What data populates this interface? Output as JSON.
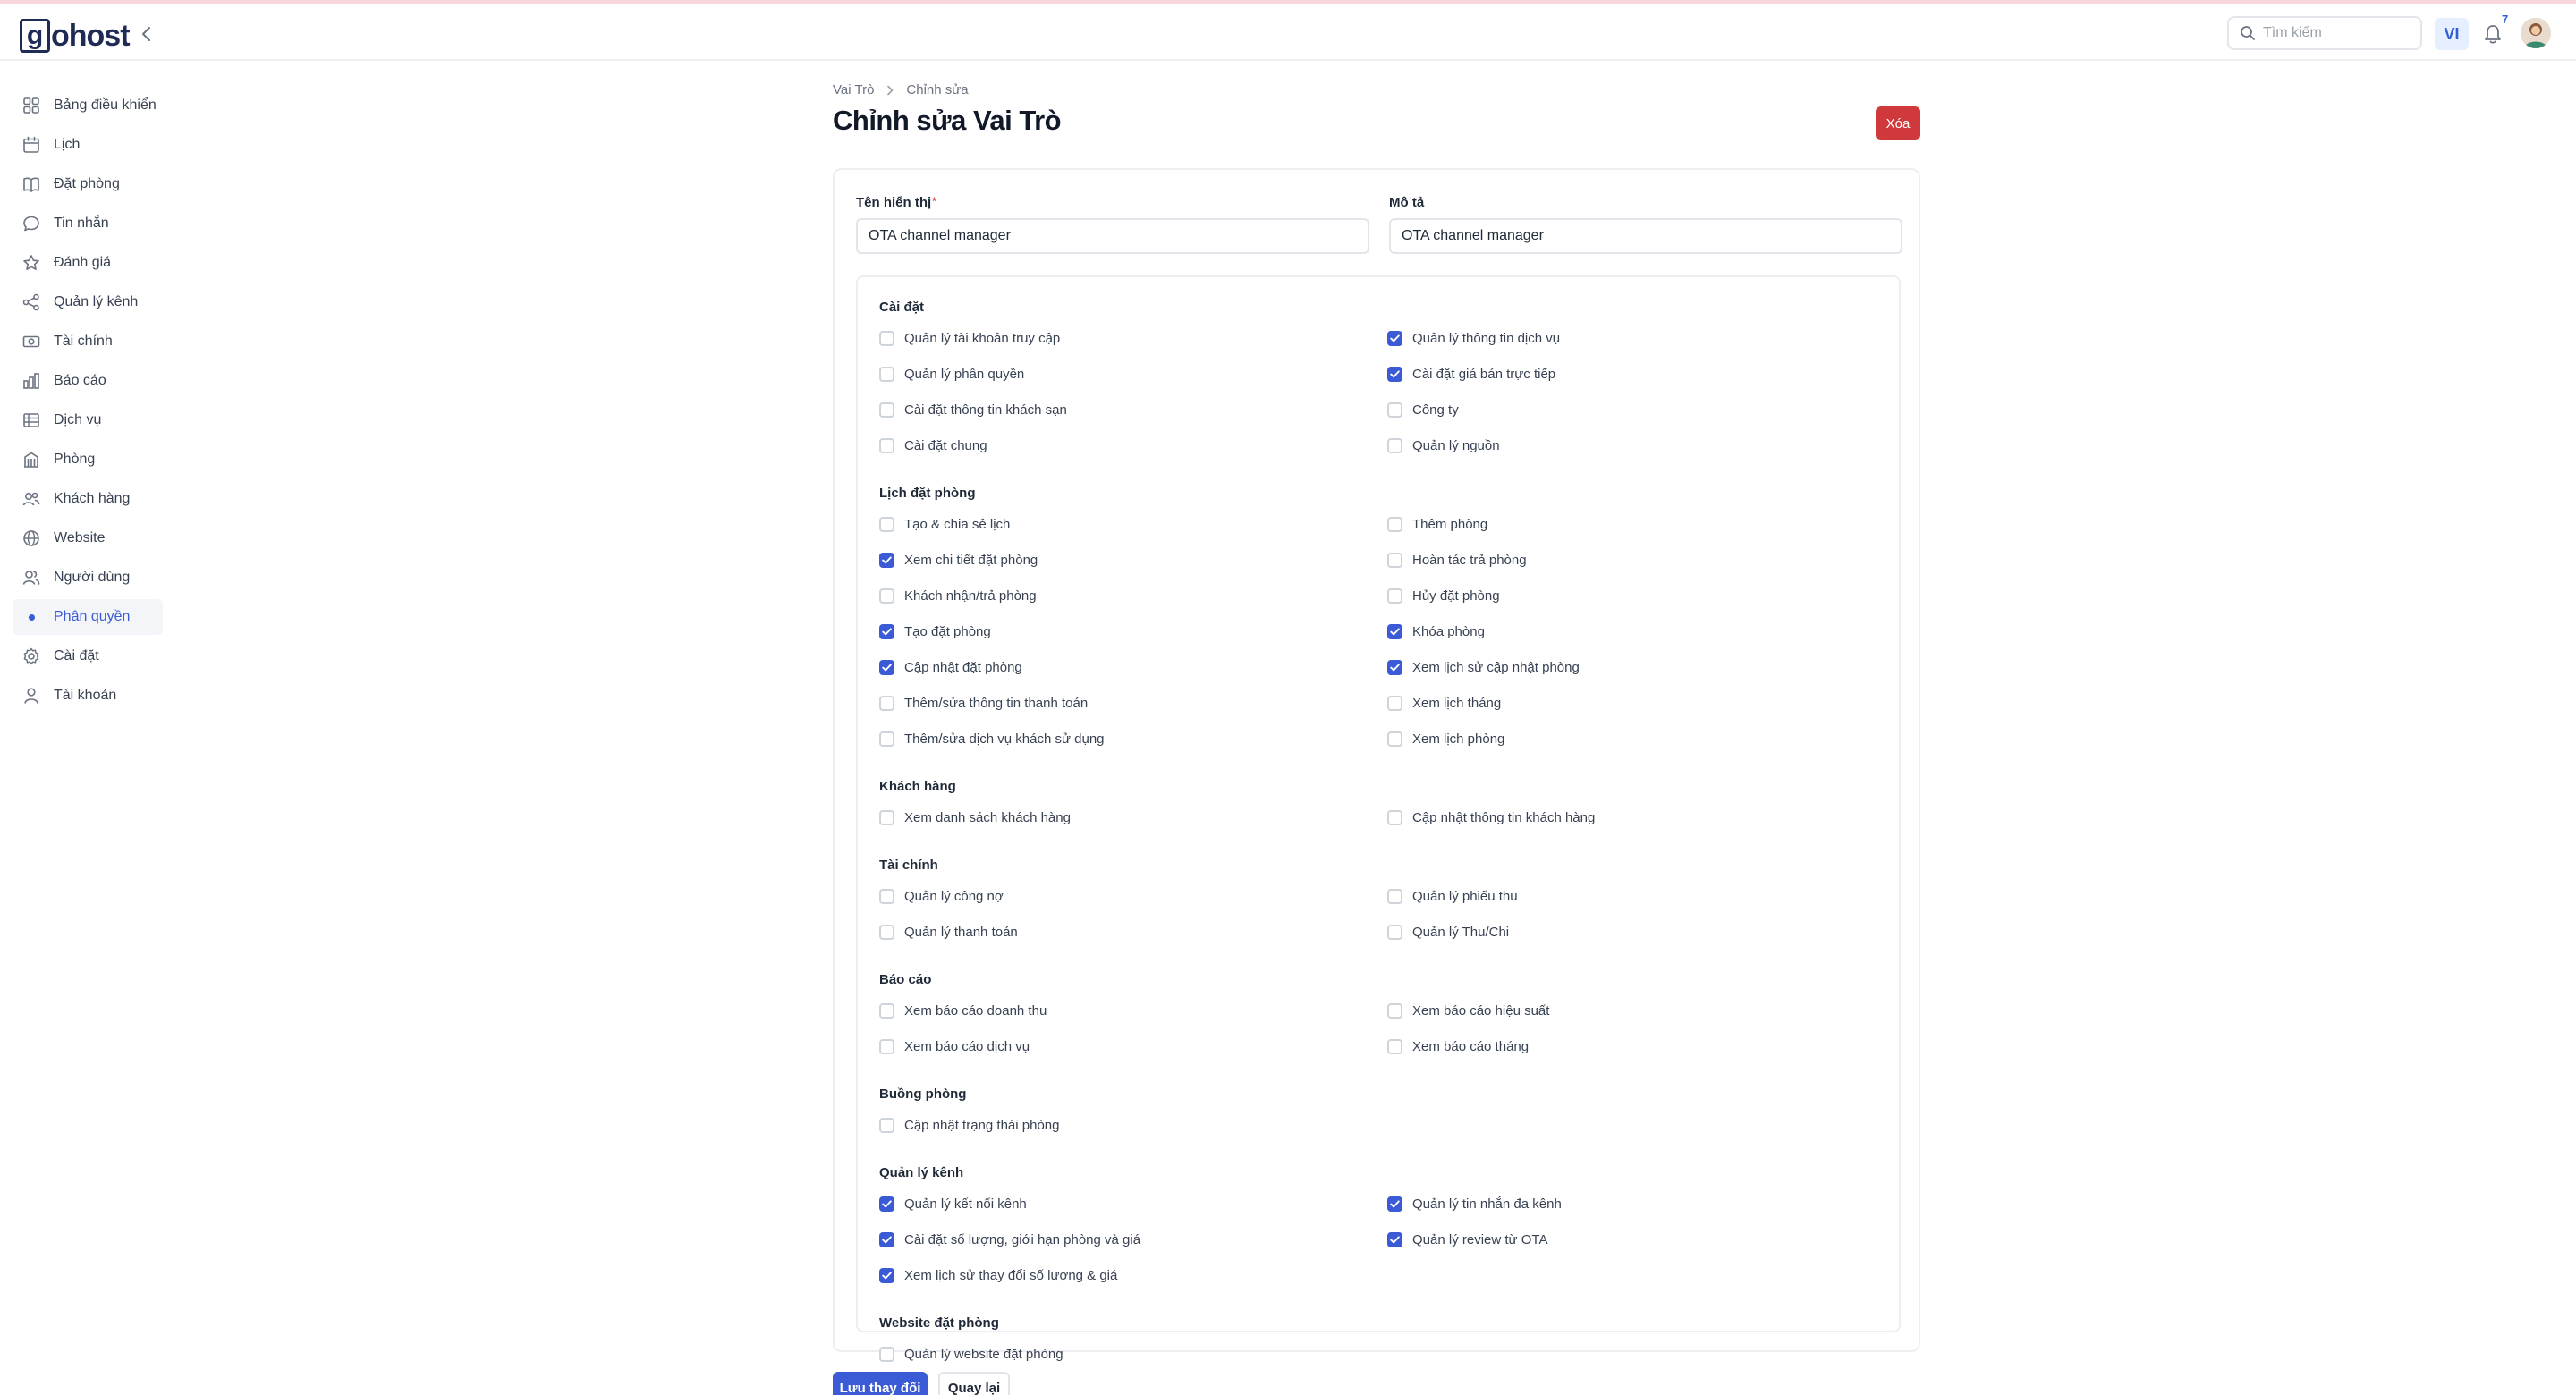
{
  "brand": {
    "logo_letter": "g",
    "logo_rest": "ohost"
  },
  "header": {
    "search_placeholder": "Tìm kiếm",
    "language": "VI",
    "notification_count": "7"
  },
  "sidebar": {
    "items": [
      {
        "label": "Bảng điều khiển",
        "icon": "dashboard-icon"
      },
      {
        "label": "Lịch",
        "icon": "calendar-icon"
      },
      {
        "label": "Đặt phòng",
        "icon": "book-icon"
      },
      {
        "label": "Tin nhắn",
        "icon": "message-icon"
      },
      {
        "label": "Đánh giá",
        "icon": "star-icon"
      },
      {
        "label": "Quản lý kênh",
        "icon": "share-icon"
      },
      {
        "label": "Tài chính",
        "icon": "money-icon"
      },
      {
        "label": "Báo cáo",
        "icon": "bar-chart-icon"
      },
      {
        "label": "Dịch vụ",
        "icon": "list-icon"
      },
      {
        "label": "Phòng",
        "icon": "building-icon"
      },
      {
        "label": "Khách hàng",
        "icon": "customers-icon"
      },
      {
        "label": "Website",
        "icon": "globe-icon"
      },
      {
        "label": "Người dùng",
        "icon": "users-icon"
      },
      {
        "label": "Phân quyền",
        "icon": "dot-icon",
        "active": true
      },
      {
        "label": "Cài đặt",
        "icon": "gear-icon"
      },
      {
        "label": "Tài khoản",
        "icon": "user-icon"
      }
    ]
  },
  "breadcrumb": {
    "parent": "Vai Trò",
    "current": "Chỉnh sửa"
  },
  "page": {
    "title": "Chỉnh sửa Vai Trò",
    "delete_label": "Xóa"
  },
  "form": {
    "name_label": "Tên hiển thị",
    "name_required_mark": "*",
    "name_value": "OTA channel manager",
    "desc_label": "Mô tả",
    "desc_value": "OTA channel manager"
  },
  "groups": [
    {
      "title": "Cài đặt",
      "left": [
        {
          "label": "Quản lý tài khoản truy cập",
          "checked": false
        },
        {
          "label": "Quản lý phân quyền",
          "checked": false
        },
        {
          "label": "Cài đặt thông tin khách sạn",
          "checked": false
        },
        {
          "label": "Cài đặt chung",
          "checked": false
        }
      ],
      "right": [
        {
          "label": "Quản lý thông tin dịch vụ",
          "checked": true
        },
        {
          "label": "Cài đặt giá bán trực tiếp",
          "checked": true
        },
        {
          "label": "Công ty",
          "checked": false
        },
        {
          "label": "Quản lý nguồn",
          "checked": false
        }
      ]
    },
    {
      "title": "Lịch đặt phòng",
      "left": [
        {
          "label": "Tạo & chia sẻ lịch",
          "checked": false
        },
        {
          "label": "Xem chi tiết đặt phòng",
          "checked": true
        },
        {
          "label": "Khách nhận/trả phòng",
          "checked": false
        },
        {
          "label": "Tạo đặt phòng",
          "checked": true
        },
        {
          "label": "Cập nhật đặt phòng",
          "checked": true
        },
        {
          "label": "Thêm/sửa thông tin thanh toán",
          "checked": false
        },
        {
          "label": "Thêm/sửa dịch vụ khách sử dụng",
          "checked": false
        }
      ],
      "right": [
        {
          "label": "Thêm phòng",
          "checked": false
        },
        {
          "label": "Hoàn tác trả phòng",
          "checked": false
        },
        {
          "label": "Hủy đặt phòng",
          "checked": false
        },
        {
          "label": "Khóa phòng",
          "checked": true
        },
        {
          "label": "Xem lịch sử cập nhật phòng",
          "checked": true
        },
        {
          "label": "Xem lịch tháng",
          "checked": false
        },
        {
          "label": "Xem lịch phòng",
          "checked": false
        }
      ]
    },
    {
      "title": "Khách hàng",
      "left": [
        {
          "label": "Xem danh sách khách hàng",
          "checked": false
        }
      ],
      "right": [
        {
          "label": "Cập nhật thông tin khách hàng",
          "checked": false
        }
      ]
    },
    {
      "title": "Tài chính",
      "left": [
        {
          "label": "Quản lý công nợ",
          "checked": false
        },
        {
          "label": "Quản lý thanh toán",
          "checked": false
        }
      ],
      "right": [
        {
          "label": "Quản lý phiếu thu",
          "checked": false
        },
        {
          "label": "Quản lý Thu/Chi",
          "checked": false
        }
      ]
    },
    {
      "title": "Báo cáo",
      "left": [
        {
          "label": "Xem báo cáo doanh thu",
          "checked": false
        },
        {
          "label": "Xem báo cáo dịch vụ",
          "checked": false
        }
      ],
      "right": [
        {
          "label": "Xem báo cáo hiệu suất",
          "checked": false
        },
        {
          "label": "Xem báo cáo tháng",
          "checked": false
        }
      ]
    },
    {
      "title": "Buồng phòng",
      "left": [
        {
          "label": "Cập nhật trạng thái phòng",
          "checked": false
        }
      ],
      "right": []
    },
    {
      "title": "Quản lý kênh",
      "left": [
        {
          "label": "Quản lý kết nối kênh",
          "checked": true
        },
        {
          "label": "Cài đặt số lượng, giới hạn phòng và giá",
          "checked": true
        },
        {
          "label": "Xem lịch sử thay đổi số lượng & giá",
          "checked": true
        }
      ],
      "right": [
        {
          "label": "Quản lý tin nhắn đa kênh",
          "checked": true
        },
        {
          "label": "Quản lý review từ OTA",
          "checked": true
        }
      ]
    },
    {
      "title": "Website đặt phòng",
      "left": [
        {
          "label": "Quản lý website đặt phòng",
          "checked": false
        }
      ],
      "right": []
    }
  ],
  "footer": {
    "save_label": "Lưu thay đổi",
    "back_label": "Quay lại"
  },
  "colors": {
    "accent": "#3b5bd6",
    "danger": "#d0393c",
    "brand": "#1f2a55"
  }
}
